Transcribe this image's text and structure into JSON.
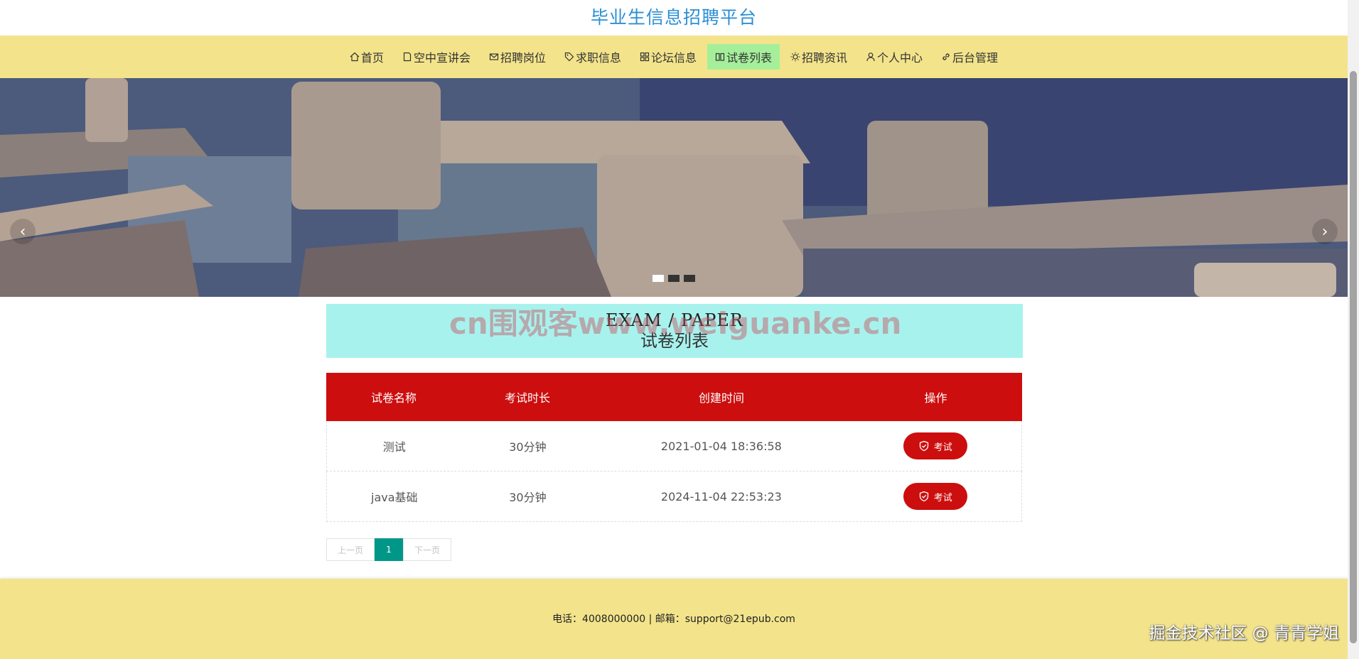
{
  "site": {
    "title": "毕业生信息招聘平台"
  },
  "nav": {
    "items": [
      {
        "label": "首页",
        "icon": "home-icon"
      },
      {
        "label": "空中宣讲会",
        "icon": "note-icon"
      },
      {
        "label": "招聘岗位",
        "icon": "mail-icon"
      },
      {
        "label": "求职信息",
        "icon": "tag-icon"
      },
      {
        "label": "论坛信息",
        "icon": "grid-icon"
      },
      {
        "label": "试卷列表",
        "icon": "book-icon",
        "active": true
      },
      {
        "label": "招聘资讯",
        "icon": "sun-icon"
      },
      {
        "label": "个人中心",
        "icon": "user-icon"
      },
      {
        "label": "后台管理",
        "icon": "link-icon"
      }
    ]
  },
  "banner": {
    "prev_arrow": "‹",
    "next_arrow": "›",
    "dots": 3,
    "active_dot": 0
  },
  "section": {
    "title_en": "EXAM / PAPER",
    "title_zh": "试卷列表",
    "watermark": "cn围观客www.weiguanke.cn"
  },
  "table": {
    "headers": [
      "试卷名称",
      "考试时长",
      "创建时间",
      "操作"
    ],
    "rows": [
      {
        "name": "测试",
        "duration": "30分钟",
        "created": "2021-01-04 18:36:58",
        "action": "考试"
      },
      {
        "name": "java基础",
        "duration": "30分钟",
        "created": "2024-11-04 22:53:23",
        "action": "考试"
      }
    ]
  },
  "pagination": {
    "prev": "上一页",
    "current": "1",
    "next": "下一页"
  },
  "footer": {
    "text": "电话：4008000000 | 邮箱：support@21epub.com"
  },
  "corner_watermark": "掘金技术社区 @ 青青学姐",
  "colors": {
    "accent_red": "#cc0e0e",
    "nav_bg": "#f3e48b",
    "title_blue": "#2d8fd5",
    "section_bg": "#a8f2ee",
    "pager_active": "#009688"
  }
}
